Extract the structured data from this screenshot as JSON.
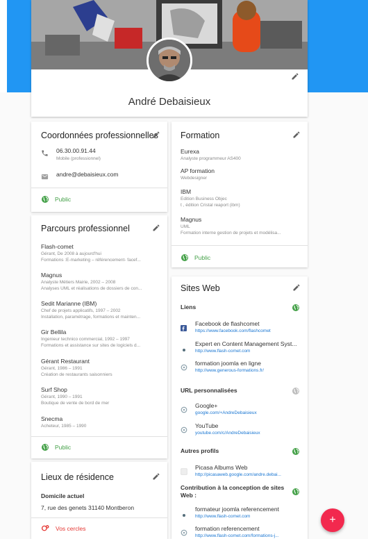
{
  "profile": {
    "name": "André Debaisieux"
  },
  "contact": {
    "title": "Coordonnées professionnelles",
    "phone": "06.30.00.91.44",
    "phone_type": "Mobile (professionnel)",
    "email": "andre@debaisieux.com",
    "visibility": "Public"
  },
  "career": {
    "title": "Parcours professionnel",
    "items": [
      {
        "name": "Flash-comet",
        "line1": "Gérant, De 2008 à aujourd'hui",
        "line2": "Formations :E-marketing – référencement- facef..."
      },
      {
        "name": "Magnus",
        "line1": "Analyste Métiers Mairie, 2002 – 2008",
        "line2": "Analyses UML et réalisations de dossiers de con..."
      },
      {
        "name": "Sedit Marianne (IBM)",
        "line1": "Chef de projets applicatifs, 1997 – 2002",
        "line2": "Installation, paramétrage, formations et mainten..."
      },
      {
        "name": "Gir Bellila",
        "line1": "Ingenieur technico commercial, 1992 – 1997",
        "line2": "Formations et assistance sur sites de logiciels d..."
      },
      {
        "name": "Gérant Restaurant",
        "line1": "Gérant, 1986 – 1991",
        "line2": "Création de restaurants saisonniers"
      },
      {
        "name": "Surf Shop",
        "line1": "Gérant, 1990 – 1991",
        "line2": "Boutique de vente de bord de mer"
      },
      {
        "name": "Snecma",
        "line1": "Acheteur, 1985 – 1990",
        "line2": ""
      }
    ],
    "visibility": "Public"
  },
  "residence": {
    "title": "Lieux de résidence",
    "current_label": "Domicile actuel",
    "address": "7, rue des genets 31140 Montberon",
    "circles": "Vos cercles"
  },
  "education": {
    "title": "Formation",
    "items": [
      {
        "name": "Eurexa",
        "line1": "Analyste programmeur AS400",
        "line2": ""
      },
      {
        "name": "AP formation",
        "line1": "Webdesigner",
        "line2": ""
      },
      {
        "name": "IBM",
        "line1": "Edition Business Objec",
        "line2": "t , édition Cristal reaport (ibm)"
      },
      {
        "name": "Magnus",
        "line1": "UML",
        "line2": "Formation interne gestion de projets et modélisa..."
      }
    ],
    "visibility": "Public"
  },
  "websites": {
    "title": "Sites Web",
    "links_label": "Liens",
    "links": [
      {
        "name": "Facebook de flashcomet",
        "url": "https://www.facebook.com/flashcomet"
      },
      {
        "name": "Expert en Content Management Syst...",
        "url": "http://www.flash-comet.com"
      },
      {
        "name": "formation joomla en ligne",
        "url": "http://www.generous-formations.fr/"
      }
    ],
    "custom_label": "URL personnalisées",
    "custom": [
      {
        "name": "Google+",
        "url": "google.com/+AndreDebaisieux"
      },
      {
        "name": "YouTube",
        "url": "youtube.com/c/AndreDebaisieux"
      }
    ],
    "other_label": "Autres profils",
    "other": [
      {
        "name": "Picasa Albums Web",
        "url": "http://picasaweb.google.com/andre.debai..."
      }
    ],
    "contrib_label": "Contribution à la conception de sites Web :",
    "contrib": [
      {
        "name": "formateur joomla referencement",
        "url": "http://www.flash-comet.com"
      },
      {
        "name": "formation referencement",
        "url": "http://www.flash-comet.com/formations-j..."
      }
    ]
  },
  "fab": {
    "label": "+"
  },
  "colors": {
    "accent_blue": "#2196f3",
    "public_green": "#43a047",
    "fab_red": "#f2294e",
    "circles_red": "#e53935"
  }
}
